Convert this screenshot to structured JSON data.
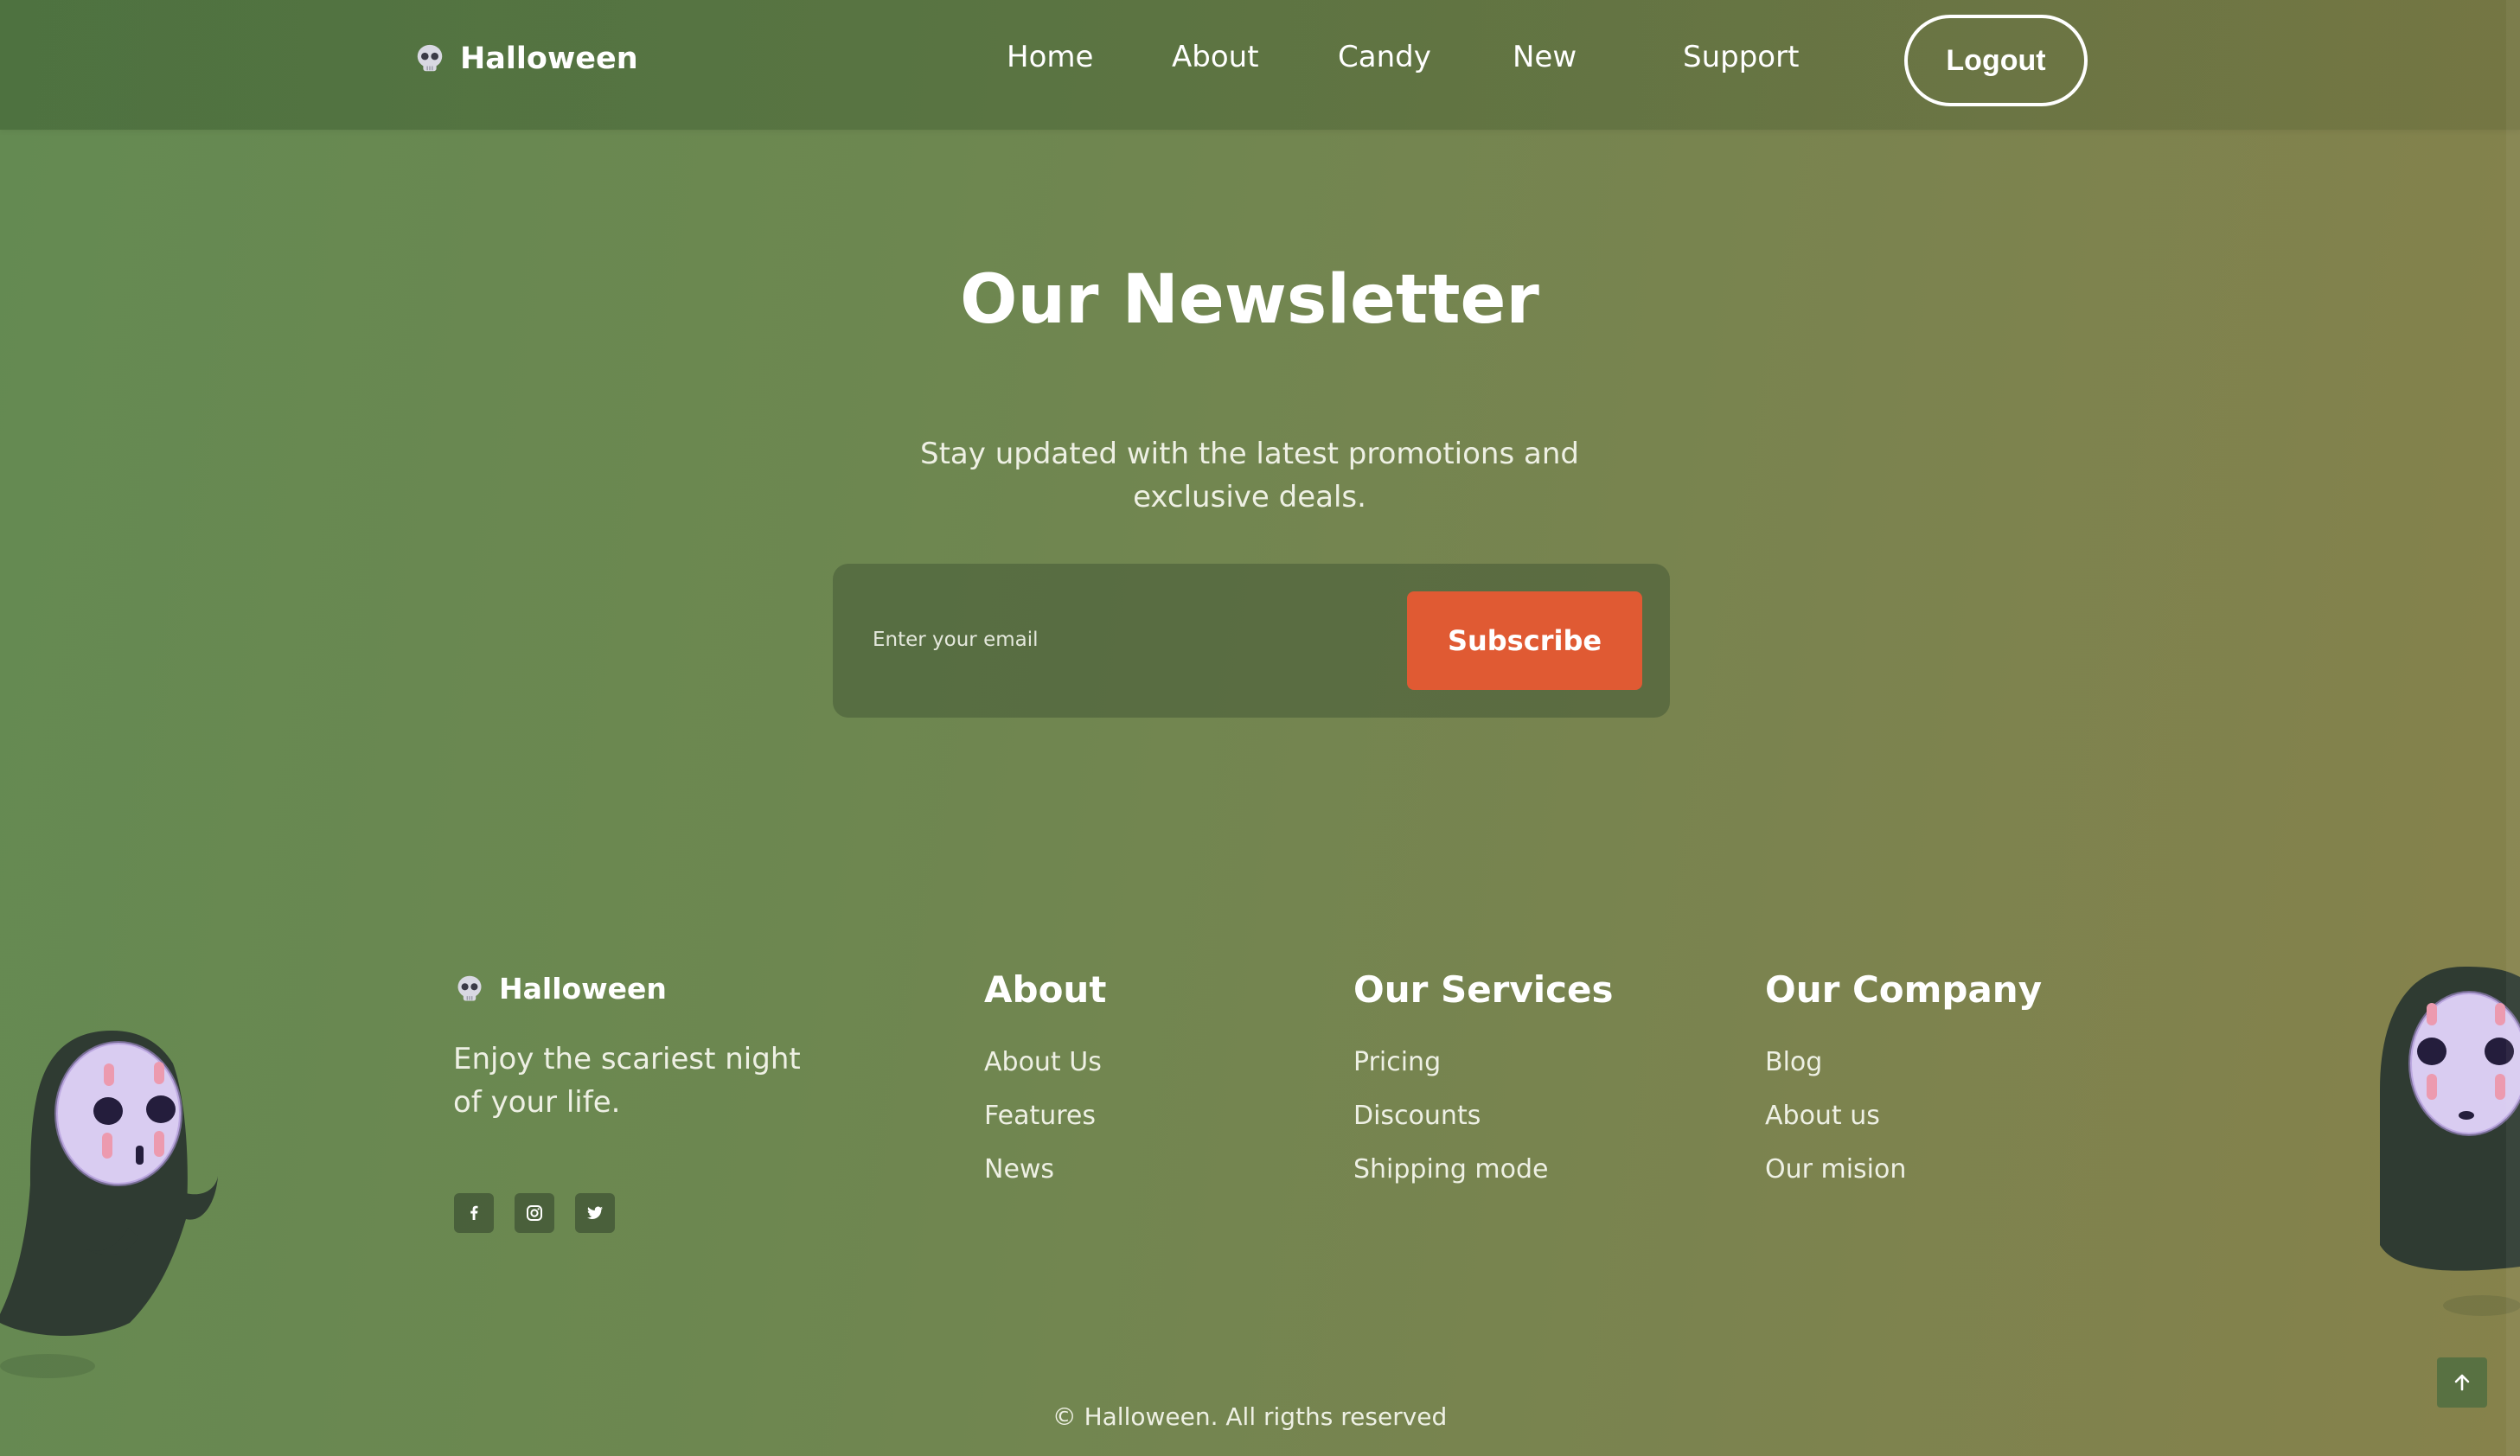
{
  "header": {
    "brand": "Halloween",
    "nav": [
      {
        "label": "Home"
      },
      {
        "label": "About"
      },
      {
        "label": "Candy"
      },
      {
        "label": "New"
      },
      {
        "label": "Support"
      }
    ],
    "logout_label": "Logout"
  },
  "newsletter": {
    "title": "Our Newsletter",
    "subtitle_line1": "Stay updated with the latest promotions and",
    "subtitle_line2": "exclusive deals.",
    "email_placeholder": "Enter your email",
    "subscribe_label": "Subscribe"
  },
  "footer": {
    "brand": "Halloween",
    "tagline_line1": "Enjoy the scariest night",
    "tagline_line2": "of your life.",
    "socials": [
      "facebook-icon",
      "instagram-icon",
      "twitter-icon"
    ],
    "columns": [
      {
        "title": "About",
        "links": [
          "About Us",
          "Features",
          "News"
        ]
      },
      {
        "title": "Our Services",
        "links": [
          "Pricing",
          "Discounts",
          "Shipping mode"
        ]
      },
      {
        "title": "Our Company",
        "links": [
          "Blog",
          "About us",
          "Our mision"
        ]
      }
    ],
    "copyright": "© Halloween. All rigths reserved"
  },
  "colors": {
    "accent": "#e05a33",
    "background_start": "#648a52",
    "background_end": "#86824b"
  }
}
